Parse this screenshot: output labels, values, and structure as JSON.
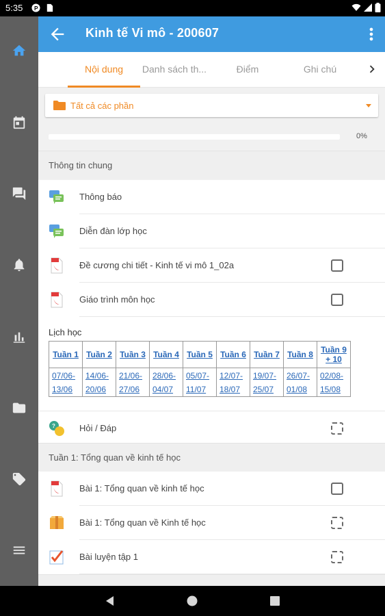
{
  "status_bar": {
    "time": "5:35"
  },
  "rail": {
    "items": [
      {
        "icon": "home-icon",
        "active": true
      },
      {
        "icon": "calendar-icon"
      },
      {
        "icon": "chat-icon"
      },
      {
        "icon": "bell-icon"
      },
      {
        "icon": "bar-chart-icon"
      },
      {
        "icon": "folder-icon"
      },
      {
        "icon": "tag-icon"
      },
      {
        "icon": "menu-icon"
      }
    ]
  },
  "app_bar": {
    "title": "Kinh tế Vi mô - 200607"
  },
  "tabs": [
    {
      "label": "Nội dung",
      "active": true
    },
    {
      "label": "Danh sách th..."
    },
    {
      "label": "Điểm"
    },
    {
      "label": "Ghi chú"
    }
  ],
  "filter": {
    "label": "Tất cả các phần"
  },
  "progress": {
    "percent": 0,
    "label": "0%"
  },
  "section_general": {
    "title": "Thông tin chung",
    "items": [
      {
        "label": "Thông báo",
        "icon": "forum-icon",
        "check": "none"
      },
      {
        "label": "Diễn đàn lớp học",
        "icon": "forum-icon",
        "check": "none"
      },
      {
        "label": "Đề cương chi tiết - Kinh tế vi mô 1_02a",
        "icon": "pdf-icon",
        "check": "box"
      },
      {
        "label": "Giáo trình môn học",
        "icon": "pdf-icon",
        "check": "box"
      }
    ]
  },
  "schedule": {
    "caption": "Lịch học",
    "weeks": [
      "Tuần 1",
      "Tuần 2",
      "Tuần 3",
      "Tuần 4",
      "Tuần 5",
      "Tuần 6",
      "Tuần 7",
      "Tuần 8",
      "Tuần 9 + 10"
    ],
    "dates": [
      "07/06-13/06",
      "14/06-20/06",
      "21/06-27/06",
      "28/06-04/07",
      "05/07-11/07",
      "12/07-18/07",
      "19/07-25/07",
      "26/07-01/08",
      "02/08-15/08"
    ]
  },
  "qa": {
    "label": "Hỏi / Đáp",
    "icon": "qa-icon",
    "check": "dashed"
  },
  "section_week1": {
    "title": "Tuần 1: Tổng quan về kinh tế học",
    "items": [
      {
        "label": "Bài 1: Tổng quan về kinh tế học",
        "icon": "pdf-icon",
        "check": "box"
      },
      {
        "label": "Bài 1: Tổng quan về Kinh tế học",
        "icon": "package-icon",
        "check": "dashed"
      },
      {
        "label": "Bài luyện tập 1",
        "icon": "quiz-icon",
        "check": "dashed"
      }
    ]
  },
  "colors": {
    "app_bar": "#3f9be0",
    "accent": "#f08a24",
    "rail": "#5f5f5f",
    "link": "#2a68b8"
  }
}
